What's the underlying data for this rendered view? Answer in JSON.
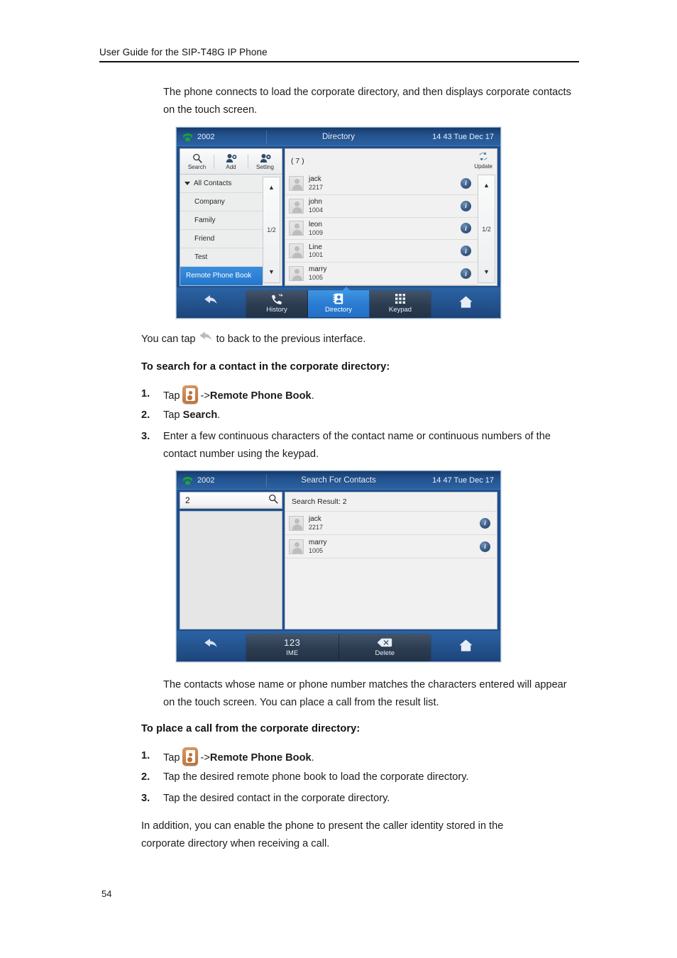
{
  "document": {
    "header_title": "User Guide for the SIP-T48G IP Phone",
    "page_number": "54",
    "intro_paragraph": "The phone connects to load the corporate directory, and then displays corporate contacts on the touch screen.",
    "tap_back_prefix": "You can tap",
    "tap_back_suffix": "to back to the previous interface.",
    "section_search_heading": "To search for a contact in the corporate directory:",
    "section_call_heading": "To place a call from the corporate directory:",
    "search_steps": [
      {
        "num": "1.",
        "prefix": "Tap",
        "icon": "remote-phone-book-icon",
        "middle": "->",
        "bold": "Remote Phone Book",
        "suffix": "."
      },
      {
        "num": "2.",
        "prefix": "Tap",
        "bold": "Search",
        "suffix": "."
      },
      {
        "num": "3.",
        "text": "Enter a few continuous characters of the contact name or continuous numbers of the contact number using the keypad."
      }
    ],
    "result_paragraph": "The contacts whose name or phone number matches the characters entered will appear on the touch screen. You can place a call from the result list.",
    "call_steps": [
      {
        "num": "1.",
        "prefix": "Tap",
        "icon": "remote-phone-book-icon",
        "middle": "->",
        "bold": "Remote Phone Book",
        "suffix": "."
      },
      {
        "num": "2.",
        "text": "Tap the desired remote phone book to load the corporate directory."
      },
      {
        "num": "3.",
        "text": "Tap the desired contact in the corporate directory."
      }
    ],
    "closing_paragraph": "In addition, you can enable the phone to present the caller identity stored in the corporate directory when receiving a call."
  },
  "screen_directory": {
    "status": {
      "line_label": "2002",
      "title": "Directory",
      "clock": "14 43 Tue Dec 17"
    },
    "toolbar": [
      {
        "label": "Search",
        "icon": "magnifier-icon"
      },
      {
        "label": "Add",
        "icon": "add-contact-icon"
      },
      {
        "label": "Setting",
        "icon": "contact-settings-icon"
      }
    ],
    "categories": [
      {
        "label": "All Contacts",
        "root": true,
        "selected": false
      },
      {
        "label": "Company",
        "root": false,
        "selected": false
      },
      {
        "label": "Family",
        "root": false,
        "selected": false
      },
      {
        "label": "Friend",
        "root": false,
        "selected": false
      },
      {
        "label": "Test",
        "root": false,
        "selected": false
      },
      {
        "label": "Remote Phone Book",
        "root": false,
        "selected": true
      }
    ],
    "left_scroll": {
      "up": "▲",
      "page": "1/2",
      "down": "▼"
    },
    "right_scroll": {
      "up": "▲",
      "page": "1/2",
      "down": "▼"
    },
    "count_label": "( 7 )",
    "update_label": "Update",
    "contacts": [
      {
        "name": "jack",
        "number": "2217"
      },
      {
        "name": "john",
        "number": "1004"
      },
      {
        "name": "leon",
        "number": "1009"
      },
      {
        "name": "Line",
        "number": "1001"
      },
      {
        "name": "marry",
        "number": "1005"
      }
    ],
    "tabs": [
      {
        "label": "History",
        "icon": "call-history-icon",
        "active": false
      },
      {
        "label": "Directory",
        "icon": "directory-icon",
        "active": true
      },
      {
        "label": "Keypad",
        "icon": "keypad-grid-icon",
        "active": false
      }
    ],
    "foot_left_icon": "back-arrow-icon",
    "foot_right_icon": "home-icon"
  },
  "screen_search": {
    "status": {
      "line_label": "2002",
      "title": "Search For Contacts",
      "clock": "14 47 Tue Dec 17"
    },
    "search_input_value": "2",
    "search_input_placeholder": "",
    "result_label": "Search Result: 2",
    "contacts": [
      {
        "name": "jack",
        "number": "2217"
      },
      {
        "name": "marry",
        "number": "1005"
      }
    ],
    "tabs": [
      {
        "label": "IME",
        "top": "123",
        "icon": "ime-123-icon",
        "active": false
      },
      {
        "label": "Delete",
        "top": "",
        "icon": "backspace-icon",
        "active": false
      }
    ],
    "foot_left_icon": "back-arrow-icon",
    "foot_right_icon": "home-icon"
  },
  "colors": {
    "status_bar_blue": "#23538f",
    "tab_active_blue": "#2a7bd0",
    "selected_category_blue": "#2277cd",
    "accent_orange": "#c9814b",
    "info_badge_navy": "#395b85",
    "phone_green": "#19a33a"
  }
}
